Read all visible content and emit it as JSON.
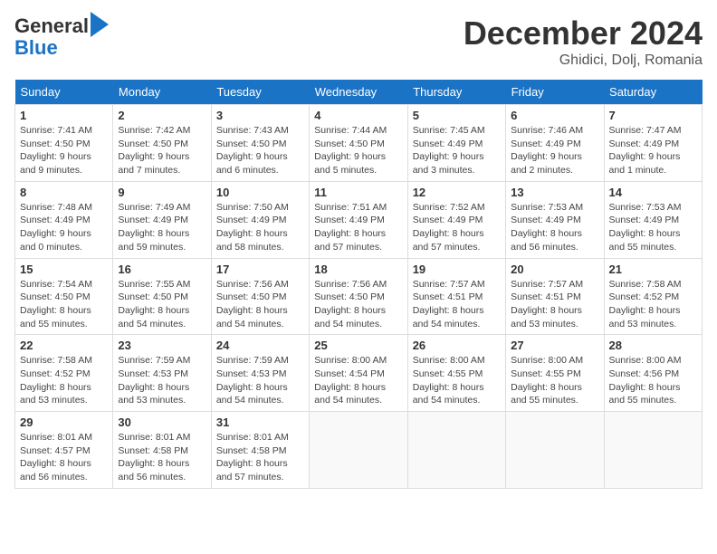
{
  "header": {
    "logo_line1": "General",
    "logo_line2": "Blue",
    "month": "December 2024",
    "location": "Ghidici, Dolj, Romania"
  },
  "weekdays": [
    "Sunday",
    "Monday",
    "Tuesday",
    "Wednesday",
    "Thursday",
    "Friday",
    "Saturday"
  ],
  "weeks": [
    [
      {
        "day": "1",
        "info": "Sunrise: 7:41 AM\nSunset: 4:50 PM\nDaylight: 9 hours\nand 9 minutes."
      },
      {
        "day": "2",
        "info": "Sunrise: 7:42 AM\nSunset: 4:50 PM\nDaylight: 9 hours\nand 7 minutes."
      },
      {
        "day": "3",
        "info": "Sunrise: 7:43 AM\nSunset: 4:50 PM\nDaylight: 9 hours\nand 6 minutes."
      },
      {
        "day": "4",
        "info": "Sunrise: 7:44 AM\nSunset: 4:50 PM\nDaylight: 9 hours\nand 5 minutes."
      },
      {
        "day": "5",
        "info": "Sunrise: 7:45 AM\nSunset: 4:49 PM\nDaylight: 9 hours\nand 3 minutes."
      },
      {
        "day": "6",
        "info": "Sunrise: 7:46 AM\nSunset: 4:49 PM\nDaylight: 9 hours\nand 2 minutes."
      },
      {
        "day": "7",
        "info": "Sunrise: 7:47 AM\nSunset: 4:49 PM\nDaylight: 9 hours\nand 1 minute."
      }
    ],
    [
      {
        "day": "8",
        "info": "Sunrise: 7:48 AM\nSunset: 4:49 PM\nDaylight: 9 hours\nand 0 minutes."
      },
      {
        "day": "9",
        "info": "Sunrise: 7:49 AM\nSunset: 4:49 PM\nDaylight: 8 hours\nand 59 minutes."
      },
      {
        "day": "10",
        "info": "Sunrise: 7:50 AM\nSunset: 4:49 PM\nDaylight: 8 hours\nand 58 minutes."
      },
      {
        "day": "11",
        "info": "Sunrise: 7:51 AM\nSunset: 4:49 PM\nDaylight: 8 hours\nand 57 minutes."
      },
      {
        "day": "12",
        "info": "Sunrise: 7:52 AM\nSunset: 4:49 PM\nDaylight: 8 hours\nand 57 minutes."
      },
      {
        "day": "13",
        "info": "Sunrise: 7:53 AM\nSunset: 4:49 PM\nDaylight: 8 hours\nand 56 minutes."
      },
      {
        "day": "14",
        "info": "Sunrise: 7:53 AM\nSunset: 4:49 PM\nDaylight: 8 hours\nand 55 minutes."
      }
    ],
    [
      {
        "day": "15",
        "info": "Sunrise: 7:54 AM\nSunset: 4:50 PM\nDaylight: 8 hours\nand 55 minutes."
      },
      {
        "day": "16",
        "info": "Sunrise: 7:55 AM\nSunset: 4:50 PM\nDaylight: 8 hours\nand 54 minutes."
      },
      {
        "day": "17",
        "info": "Sunrise: 7:56 AM\nSunset: 4:50 PM\nDaylight: 8 hours\nand 54 minutes."
      },
      {
        "day": "18",
        "info": "Sunrise: 7:56 AM\nSunset: 4:50 PM\nDaylight: 8 hours\nand 54 minutes."
      },
      {
        "day": "19",
        "info": "Sunrise: 7:57 AM\nSunset: 4:51 PM\nDaylight: 8 hours\nand 54 minutes."
      },
      {
        "day": "20",
        "info": "Sunrise: 7:57 AM\nSunset: 4:51 PM\nDaylight: 8 hours\nand 53 minutes."
      },
      {
        "day": "21",
        "info": "Sunrise: 7:58 AM\nSunset: 4:52 PM\nDaylight: 8 hours\nand 53 minutes."
      }
    ],
    [
      {
        "day": "22",
        "info": "Sunrise: 7:58 AM\nSunset: 4:52 PM\nDaylight: 8 hours\nand 53 minutes."
      },
      {
        "day": "23",
        "info": "Sunrise: 7:59 AM\nSunset: 4:53 PM\nDaylight: 8 hours\nand 53 minutes."
      },
      {
        "day": "24",
        "info": "Sunrise: 7:59 AM\nSunset: 4:53 PM\nDaylight: 8 hours\nand 54 minutes."
      },
      {
        "day": "25",
        "info": "Sunrise: 8:00 AM\nSunset: 4:54 PM\nDaylight: 8 hours\nand 54 minutes."
      },
      {
        "day": "26",
        "info": "Sunrise: 8:00 AM\nSunset: 4:55 PM\nDaylight: 8 hours\nand 54 minutes."
      },
      {
        "day": "27",
        "info": "Sunrise: 8:00 AM\nSunset: 4:55 PM\nDaylight: 8 hours\nand 55 minutes."
      },
      {
        "day": "28",
        "info": "Sunrise: 8:00 AM\nSunset: 4:56 PM\nDaylight: 8 hours\nand 55 minutes."
      }
    ],
    [
      {
        "day": "29",
        "info": "Sunrise: 8:01 AM\nSunset: 4:57 PM\nDaylight: 8 hours\nand 56 minutes."
      },
      {
        "day": "30",
        "info": "Sunrise: 8:01 AM\nSunset: 4:58 PM\nDaylight: 8 hours\nand 56 minutes."
      },
      {
        "day": "31",
        "info": "Sunrise: 8:01 AM\nSunset: 4:58 PM\nDaylight: 8 hours\nand 57 minutes."
      },
      {
        "day": "",
        "info": ""
      },
      {
        "day": "",
        "info": ""
      },
      {
        "day": "",
        "info": ""
      },
      {
        "day": "",
        "info": ""
      }
    ]
  ]
}
